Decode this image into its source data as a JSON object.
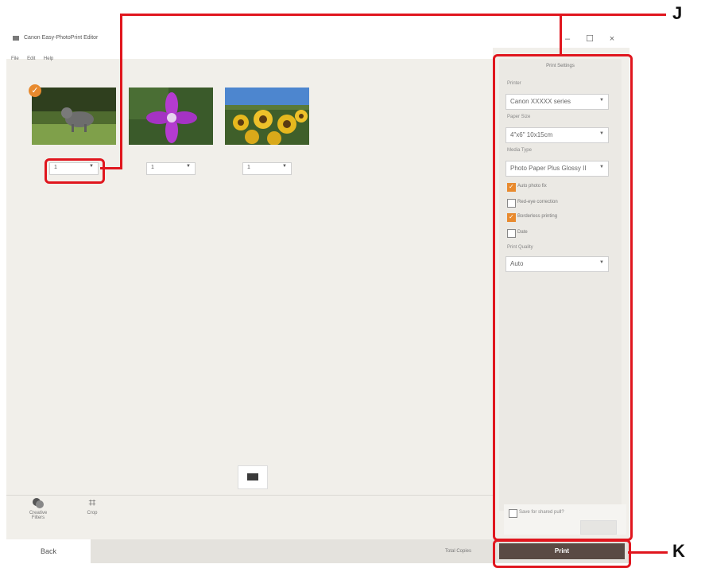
{
  "window": {
    "title": "Canon Easy-PhotoPrint Editor",
    "minimize": "–",
    "maximize": "☐",
    "close": "×"
  },
  "menu": [
    "File",
    "Edit",
    "Help"
  ],
  "photos": [
    {
      "name": "cat-photo",
      "copies": "1"
    },
    {
      "name": "flower-photo",
      "copies": "1"
    },
    {
      "name": "sunflower-photo",
      "copies": "1"
    }
  ],
  "tools": {
    "creative_filters": "Creative Filters",
    "crop": "Crop"
  },
  "settings": {
    "heading": "Print Settings",
    "printer_label": "Printer",
    "printer_value": "Canon XXXXX series",
    "paper_size_label": "Paper Size",
    "paper_size_value": "4\"x6\" 10x15cm",
    "media_type_label": "Media Type",
    "media_type_value": "Photo Paper Plus Glossy II",
    "quality_label": "Print Quality",
    "quality_value": "Auto",
    "checkboxes": [
      {
        "label": "Auto photo fix",
        "checked": true
      },
      {
        "label": "Red-eye correction",
        "checked": false
      },
      {
        "label": "Borderless printing",
        "checked": true
      },
      {
        "label": "Date",
        "checked": false
      }
    ],
    "save_label": "Save for shared pull?"
  },
  "bottom": {
    "back": "Back",
    "total_copies": "Total Copies",
    "print": "Print"
  },
  "callouts": {
    "j": "J",
    "k": "K"
  },
  "colors": {
    "callout": "#e0161e",
    "print_button": "#5a4a44",
    "check_accent": "#e88a2e"
  }
}
